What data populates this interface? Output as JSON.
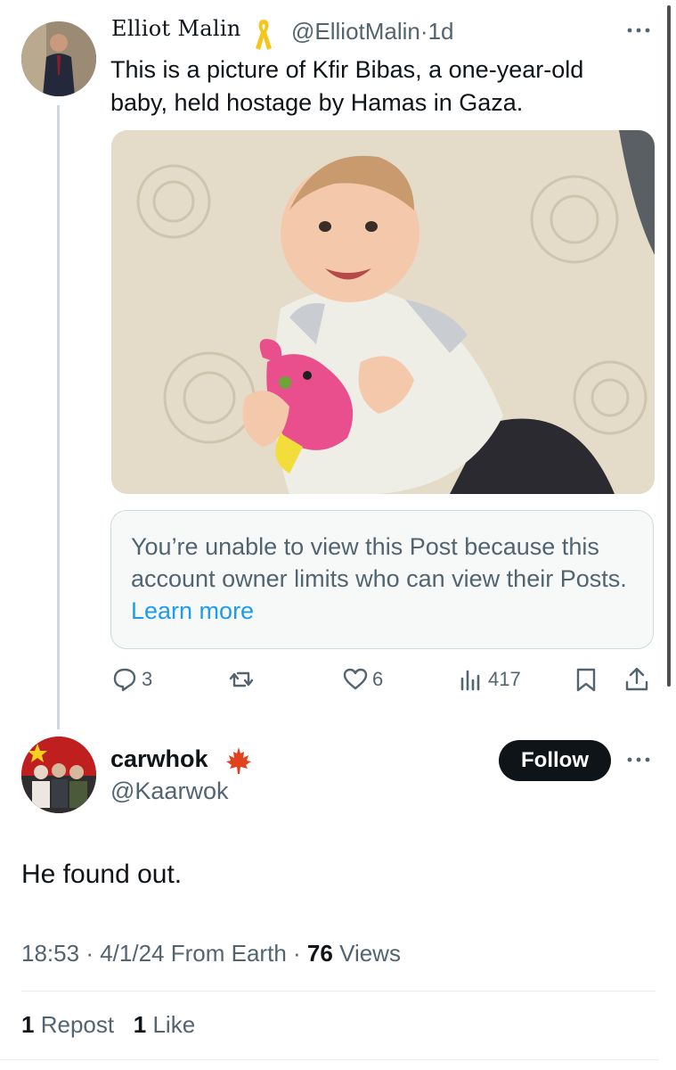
{
  "original_post": {
    "author_name": "Elliot Malin",
    "handle": "@ElliotMalin",
    "time_separator": "·",
    "time": "1d",
    "text": "This is a picture of Kfir Bibas, a one-year-old baby, held hostage by Hamas in Gaza.",
    "quoted_notice": {
      "text": "You’re unable to view this Post because this account owner limits who can view their Posts.",
      "link": "Learn more"
    },
    "actions": {
      "replies": "3",
      "likes": "6",
      "views": "417"
    }
  },
  "reply_post": {
    "author_name": "carwhok",
    "handle": "@Kaarwok",
    "follow_label": "Follow",
    "text": "He found out.",
    "time": "18:53",
    "date": "4/1/24",
    "source": "From Earth",
    "views_count": "76",
    "views_label": "Views",
    "sep": "·",
    "reposts_count": "1",
    "reposts_label": "Repost",
    "likes_count": "1",
    "likes_label": "Like"
  },
  "colors": {
    "text_primary": "#0f1419",
    "text_secondary": "#536471",
    "link": "#1d9bf0",
    "follow_bg": "#0f1419"
  },
  "icons": [
    "ellipsis-icon",
    "yellow-ribbon-icon",
    "reply-icon",
    "repost-icon",
    "like-icon",
    "views-icon",
    "bookmark-icon",
    "share-icon",
    "maple-leaf-icon"
  ]
}
